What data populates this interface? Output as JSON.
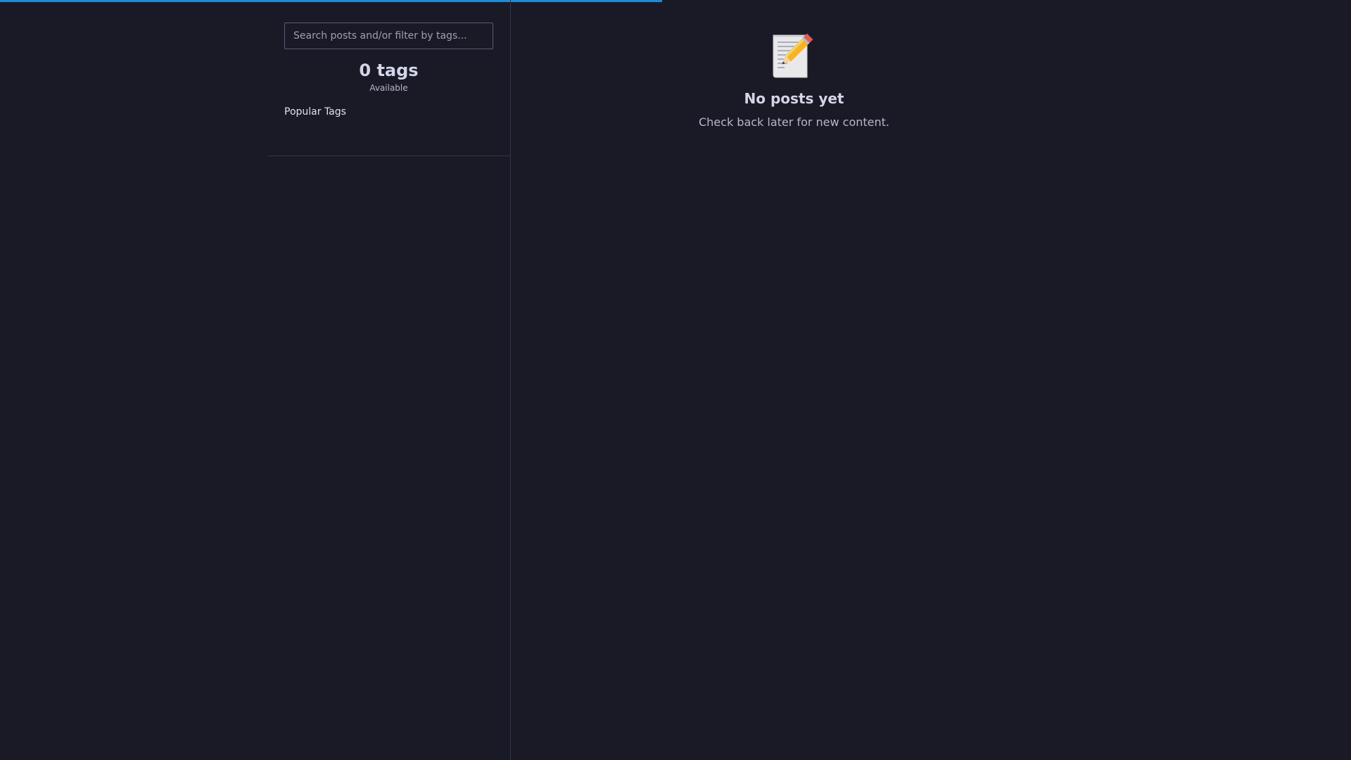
{
  "page_load": {
    "progress_percent": 49
  },
  "sidebar": {
    "search": {
      "placeholder": "Search posts and/or filter by tags...",
      "value": ""
    },
    "tags_summary": {
      "count_label": "0 tags",
      "sub_label": "Available"
    },
    "popular_tags": {
      "title": "Popular Tags",
      "items": []
    }
  },
  "main": {
    "empty_state": {
      "icon": "memo-icon",
      "title": "No posts yet",
      "message": "Check back later for new content."
    }
  },
  "colors": {
    "background": "#191a26",
    "accent": "#1f8ad6",
    "divider": "#33364a"
  }
}
